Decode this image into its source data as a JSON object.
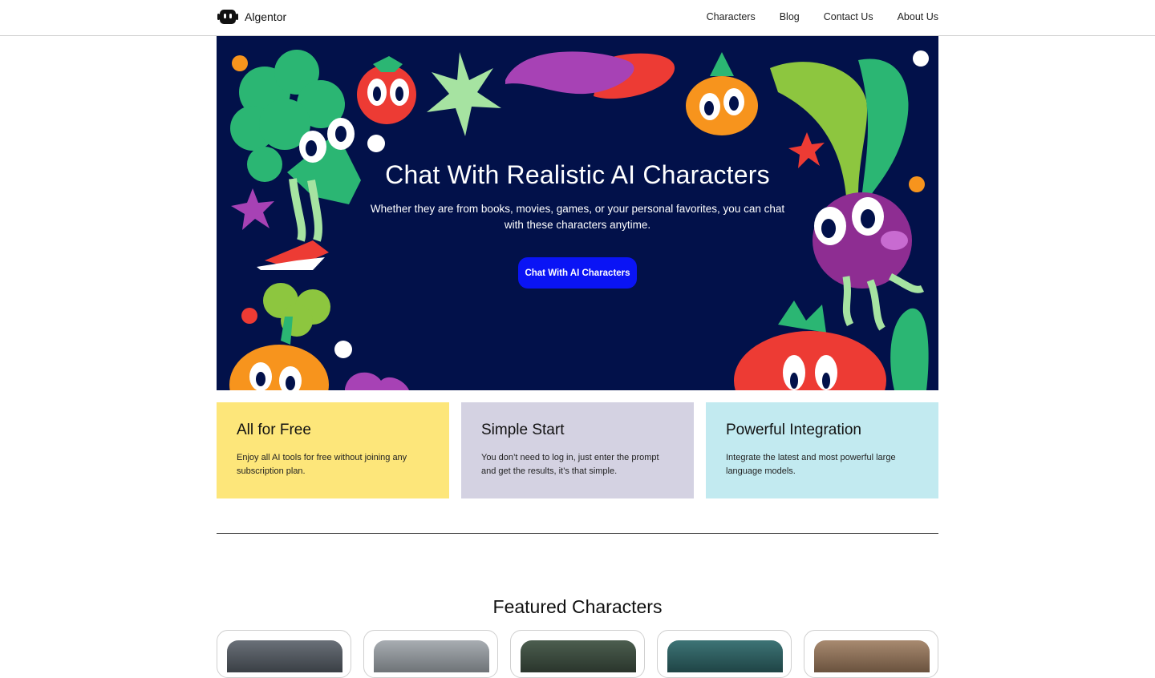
{
  "header": {
    "brand": "Algentor",
    "nav": [
      "Characters",
      "Blog",
      "Contact Us",
      "About Us"
    ]
  },
  "hero": {
    "title": "Chat With Realistic AI Characters",
    "subtitle": "Whether they are from books, movies, games, or your personal favorites, you can chat with these characters anytime.",
    "cta": "Chat With AI Characters",
    "background_color": "#02114a",
    "cta_color": "#0a14f5"
  },
  "features": [
    {
      "title": "All for Free",
      "text": "Enjoy all AI tools for free without joining any subscription plan.",
      "color": "#fde67a"
    },
    {
      "title": "Simple Start",
      "text": "You don’t need to log in, just enter the prompt and get the results, it’s that simple.",
      "color": "#d4d2e2"
    },
    {
      "title": "Powerful Integration",
      "text": "Integrate the latest and most powerful large language models.",
      "color": "#c2eaf0"
    }
  ],
  "featured": {
    "title": "Featured Characters",
    "thumbnails": [
      "#4a5058",
      "#8a8f95",
      "#3a4a3e",
      "#2e5a5c",
      "#8a6e58"
    ]
  },
  "icons": {
    "brand_logo": "robot-face-icon"
  }
}
